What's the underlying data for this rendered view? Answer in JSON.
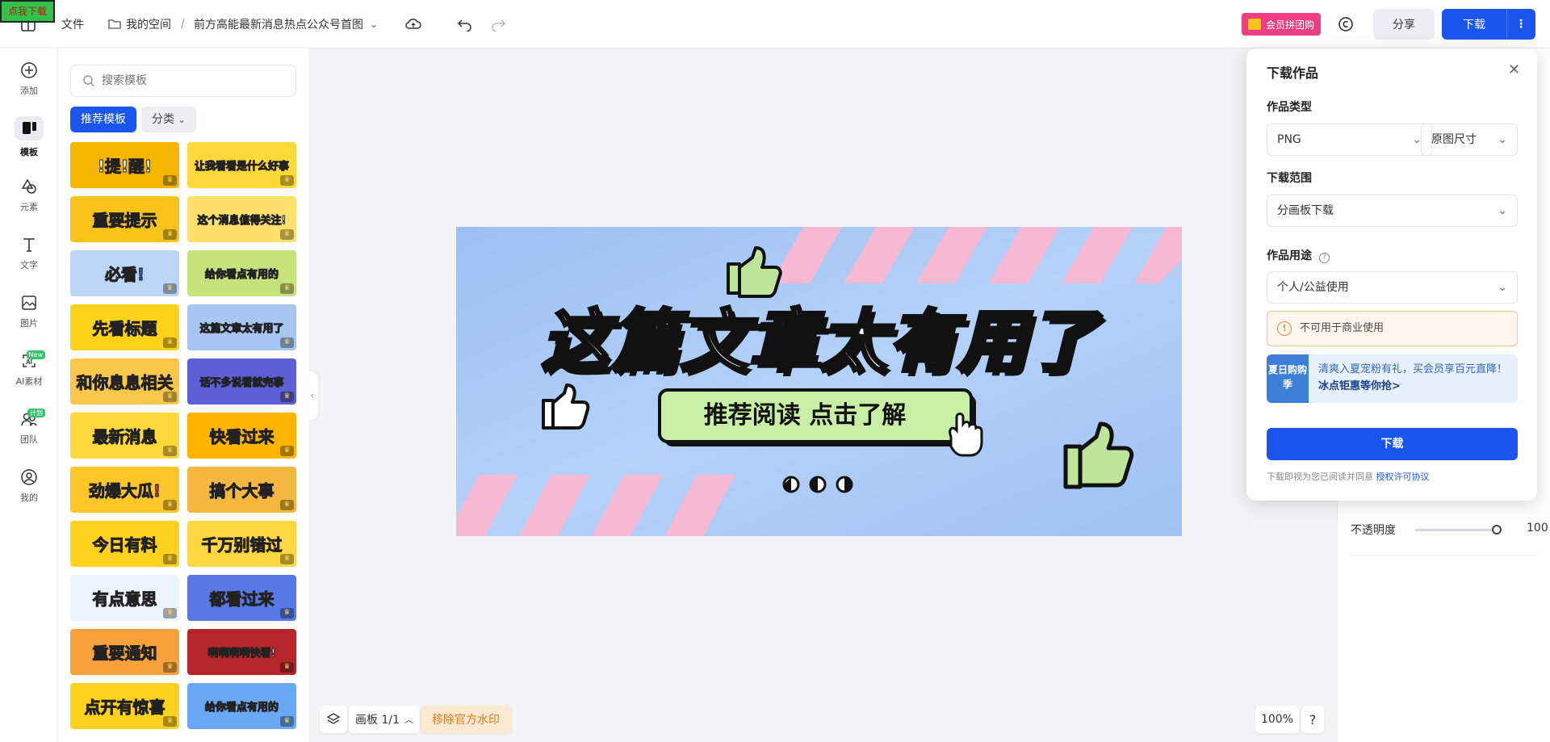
{
  "topbar": {
    "ad_label": "点我下载",
    "file_label": "文件",
    "space_label": "我的空间",
    "separator": "/",
    "doc_title": "前方高能最新消息热点公众号首图",
    "vip_label": "会员拼团购",
    "share_label": "分享",
    "download_label": "下载"
  },
  "sidebar": {
    "items": [
      {
        "label": "添加",
        "icon": "plus-circle-icon"
      },
      {
        "label": "模板",
        "icon": "template-icon"
      },
      {
        "label": "元素",
        "icon": "shapes-icon"
      },
      {
        "label": "文字",
        "icon": "text-icon"
      },
      {
        "label": "图片",
        "icon": "image-icon"
      },
      {
        "label": "AI素材",
        "icon": "ai-icon",
        "badge": "New"
      },
      {
        "label": "团队",
        "icon": "team-icon",
        "badge": "计划"
      },
      {
        "label": "我的",
        "icon": "user-icon"
      }
    ]
  },
  "panel": {
    "search_placeholder": "搜索模板",
    "tab_recommended": "推荐模板",
    "tab_category": "分类",
    "templates": [
      {
        "text": "!提!醒!",
        "bg": "#f7b500",
        "fg": "#ffffff"
      },
      {
        "text": "让我看看是什么好事",
        "bg": "#ffd83a",
        "fg": "#ffffff"
      },
      {
        "text": "重要提示",
        "bg": "#f8c41a",
        "fg": "#e3302b"
      },
      {
        "text": "这个消息值得关注!",
        "bg": "#ffe06a",
        "fg": "#ffffff"
      },
      {
        "text": "必看!",
        "bg": "#bcd6f7",
        "fg": "#2b5fd9"
      },
      {
        "text": "给你看点有用的",
        "bg": "#c5e27b",
        "fg": "#ffffff"
      },
      {
        "text": "先看标题",
        "bg": "#ffd31a",
        "fg": "#222222"
      },
      {
        "text": "这篇文章太有用了",
        "bg": "#a7c6f3",
        "fg": "#ffffff"
      },
      {
        "text": "和你息息相关",
        "bg": "#f9c74a",
        "fg": "#ffffff"
      },
      {
        "text": "话不多说看就完事",
        "bg": "#5c5fd6",
        "fg": "#ffd83a"
      },
      {
        "text": "最新消息",
        "bg": "#ffd83a",
        "fg": "#ffffff"
      },
      {
        "text": "快看过来",
        "bg": "#ffb400",
        "fg": "#e3302b"
      },
      {
        "text": "劲爆大瓜!",
        "bg": "#ffc629",
        "fg": "#e3302b"
      },
      {
        "text": "搞个大事",
        "bg": "#f4b740",
        "fg": "#ffffff"
      },
      {
        "text": "今日有料",
        "bg": "#ffd21e",
        "fg": "#e3302b"
      },
      {
        "text": "千万别错过",
        "bg": "#ffd740",
        "fg": "#ffffff"
      },
      {
        "text": "有点意思",
        "bg": "#eef4ff",
        "fg": "#f08a1c"
      },
      {
        "text": "都看过来",
        "bg": "#5a78e6",
        "fg": "#ffd83a"
      },
      {
        "text": "重要通知",
        "bg": "#f9a13a",
        "fg": "#ffffff"
      },
      {
        "text": "啊啊啊啊快看!",
        "bg": "#b5252a",
        "fg": "#ffffff"
      },
      {
        "text": "点开有惊喜",
        "bg": "#ffd21e",
        "fg": "#222222"
      },
      {
        "text": "给你看点有用的",
        "bg": "#6aa7f5",
        "fg": "#ffffff"
      }
    ]
  },
  "canvas": {
    "headline": "这篇文章太有用了",
    "button_text": "推荐阅读 点击了解"
  },
  "bottombar": {
    "page_label": "画板 1/1",
    "watermark_label": "移除官方水印",
    "zoom": "100%",
    "help": "?"
  },
  "right": {
    "opacity_label": "不透明度",
    "opacity_value": "100"
  },
  "dialog": {
    "title": "下载作品",
    "type_label": "作品类型",
    "type_value": "PNG",
    "size_value": "原图尺寸",
    "range_label": "下载范围",
    "range_value": "分画板下载",
    "usage_label": "作品用途",
    "usage_value": "个人/公益使用",
    "warning": "不可用于商业使用",
    "promo_badge": "夏日购购季",
    "promo_line1": "清爽入夏宠粉有礼，买会员享百元直降！",
    "promo_link": "冰点钜惠等你抢>",
    "download_button": "下载",
    "agreement_prefix": "下载即视为您已阅读并同意",
    "agreement_link": "授权许可协议"
  }
}
